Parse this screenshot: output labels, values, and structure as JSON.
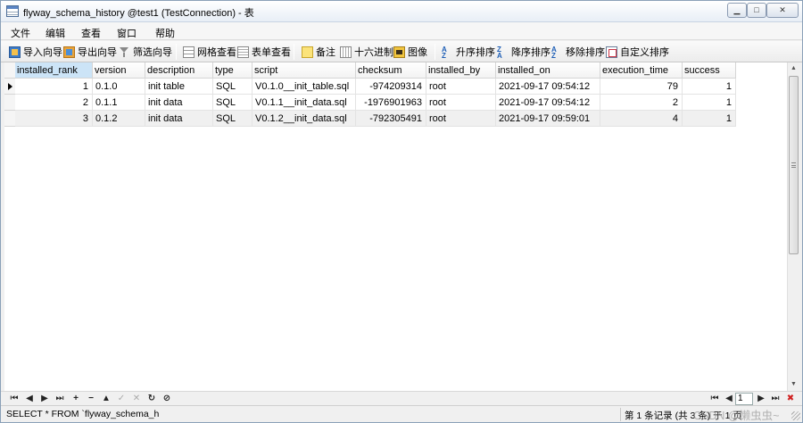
{
  "window": {
    "title": "flyway_schema_history @test1 (TestConnection) - 表",
    "buttons": {
      "minimize": "▁",
      "maximize": "□",
      "close": "✕"
    }
  },
  "menu": [
    "文件",
    "编辑",
    "查看",
    "窗口",
    "帮助"
  ],
  "toolbar": {
    "import": "导入向导",
    "export": "导出向导",
    "filter": "筛选向导",
    "grid_view": "网格查看",
    "form_view": "表单查看",
    "memo": "备注",
    "hex": "十六进制",
    "image": "图像",
    "sort_asc": "升序排序",
    "sort_desc": "降序排序",
    "remove_sort": "移除排序",
    "custom_sort": "自定义排序"
  },
  "table": {
    "columns": [
      "installed_rank",
      "version",
      "description",
      "type",
      "script",
      "checksum",
      "installed_by",
      "installed_on",
      "execution_time",
      "success"
    ],
    "rows": [
      [
        "1",
        "0.1.0",
        "init table",
        "SQL",
        "V0.1.0__init_table.sql",
        "-974209314",
        "root",
        "2021-09-17 09:54:12",
        "79",
        "1"
      ],
      [
        "2",
        "0.1.1",
        "init data",
        "SQL",
        "V0.1.1__init_data.sql",
        "-1976901963",
        "root",
        "2021-09-17 09:54:12",
        "2",
        "1"
      ],
      [
        "3",
        "0.1.2",
        "init data",
        "SQL",
        "V0.1.2__init_data.sql",
        "-792305491",
        "root",
        "2021-09-17 09:59:01",
        "4",
        "1"
      ]
    ]
  },
  "navigation": {
    "first": "⏮",
    "prev": "◀",
    "next": "▶",
    "last": "⏭",
    "add": "+",
    "delete": "−",
    "up": "▲",
    "apply": "✓",
    "cancel": "✕",
    "refresh": "↻",
    "stop": "⊘",
    "page_first": "⏮",
    "page_prev": "◀",
    "page_value": "1",
    "page_next": "▶",
    "page_last": "⏭",
    "page_close": "✖"
  },
  "status": {
    "sql": "SELECT * FROM `flyway_schema_h",
    "records": "第 1 条记录 (共 3 条) 于 1 页",
    "watermark": "CSDN @懒虫虫~"
  }
}
